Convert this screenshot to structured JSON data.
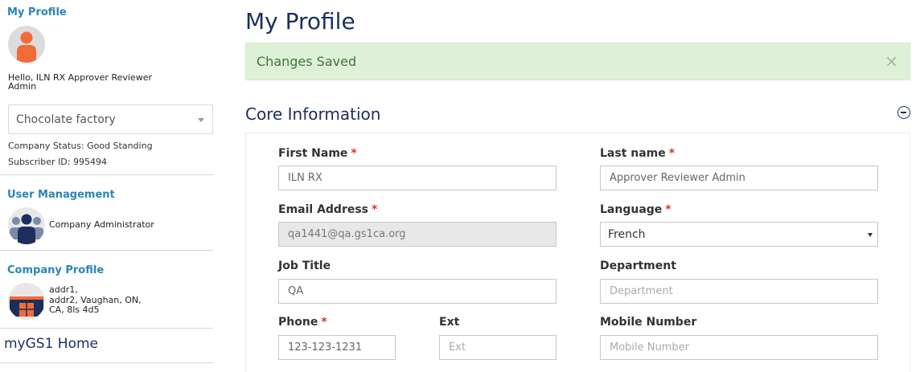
{
  "sidebar": {
    "profile_title": "My Profile",
    "hello_line1": "Hello, ILN RX Approver Reviewer",
    "hello_line2": "Admin",
    "company_select": {
      "value": "Chocolate factory"
    },
    "company_status": "Company Status: Good Standing",
    "subscriber_id": "Subscriber ID: 995494",
    "user_management_title": "User Management",
    "user_role": "Company Administrator",
    "company_profile_title": "Company Profile",
    "company_address": [
      "addr1,",
      "addr2, Vaughan, ON,",
      "CA, 8ls 4d5"
    ],
    "home_link": "myGS1 Home"
  },
  "main": {
    "page_title": "My Profile",
    "alert": {
      "text": "Changes Saved",
      "close_glyph": "×"
    },
    "section_title": "Core Information",
    "required_marker": "*",
    "fields": {
      "first_name": {
        "label": "First Name",
        "value": "ILN RX",
        "required": true
      },
      "last_name": {
        "label": "Last name",
        "value": "Approver Reviewer Admin",
        "required": true
      },
      "email": {
        "label": "Email Address",
        "value": "qa1441@qa.gs1ca.org",
        "required": true
      },
      "language": {
        "label": "Language",
        "value": "French",
        "required": true
      },
      "job_title": {
        "label": "Job Title",
        "value": "QA"
      },
      "department": {
        "label": "Department",
        "placeholder": "Department"
      },
      "phone": {
        "label": "Phone",
        "value": "123-123-1231",
        "required": true
      },
      "ext": {
        "label": "Ext",
        "placeholder": "Ext"
      },
      "mobile": {
        "label": "Mobile Number",
        "placeholder": "Mobile Number"
      }
    }
  },
  "colors": {
    "brand_navy": "#1a2f5c",
    "link_blue": "#2a86b5",
    "success_bg": "#dff0d8",
    "success_text": "#3c763d",
    "required_red": "#d9342b",
    "avatar_orange": "#f26b38"
  },
  "icons": {
    "profile_avatar": "person-avatar-icon",
    "users_avatar": "users-group-icon",
    "company_avatar": "building-icon",
    "collapse": "minus-circle-icon",
    "close": "close-icon"
  }
}
